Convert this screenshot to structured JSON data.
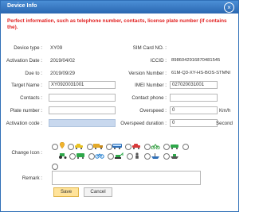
{
  "window": {
    "title": "Device Info"
  },
  "warning": "Perfect information, such as telephone number, contacts, license plate number (if contains the).",
  "left": {
    "device_type": {
      "label": "Device type :",
      "value": "XY09"
    },
    "activation_date": {
      "label": "Activation Date :",
      "value": "2019/04/02"
    },
    "due_to": {
      "label": "Due to :",
      "value": "2019/09/29"
    },
    "target_name": {
      "label": "Target Name :",
      "value": "XY0920031001"
    },
    "contacts": {
      "label": "Contacts :",
      "value": ""
    },
    "plate_number": {
      "label": "Plate number :",
      "value": ""
    },
    "activation_code": {
      "label": "Activation code :",
      "value": ""
    }
  },
  "right": {
    "sim_card_no": {
      "label": "SIM Card NO. :",
      "value": ""
    },
    "iccid": {
      "label": "ICCID :",
      "value": "8986042916870481545"
    },
    "version_number": {
      "label": "Version Number :",
      "value": "61M-Q3-XY-HS-BOS-STMNI"
    },
    "imei_number": {
      "label": "IMEI Number :",
      "value": "027020031001"
    },
    "contact_phone": {
      "label": "Contact phone :",
      "value": ""
    },
    "overspeed": {
      "label": "Overspeed :",
      "value": "0",
      "unit": "Km/h"
    },
    "overspeed_duration": {
      "label": "Overspeed duration :",
      "value": "0",
      "unit": "Second"
    }
  },
  "change_icon": {
    "label": "Change Icon :",
    "options": [
      "pin-icon",
      "car-icon",
      "truck-icon",
      "bus-icon",
      "car-red-icon",
      "motorcycle-icon",
      "scooter-icon",
      "tractor-icon",
      "train-icon",
      "bicycle-icon",
      "excavator-icon",
      "person-icon",
      "boat-icon",
      "ship-icon"
    ],
    "selected_index": 0
  },
  "remark": {
    "label": "Remark :",
    "value": ""
  },
  "buttons": {
    "save": "Save",
    "cancel": "Cancel"
  }
}
